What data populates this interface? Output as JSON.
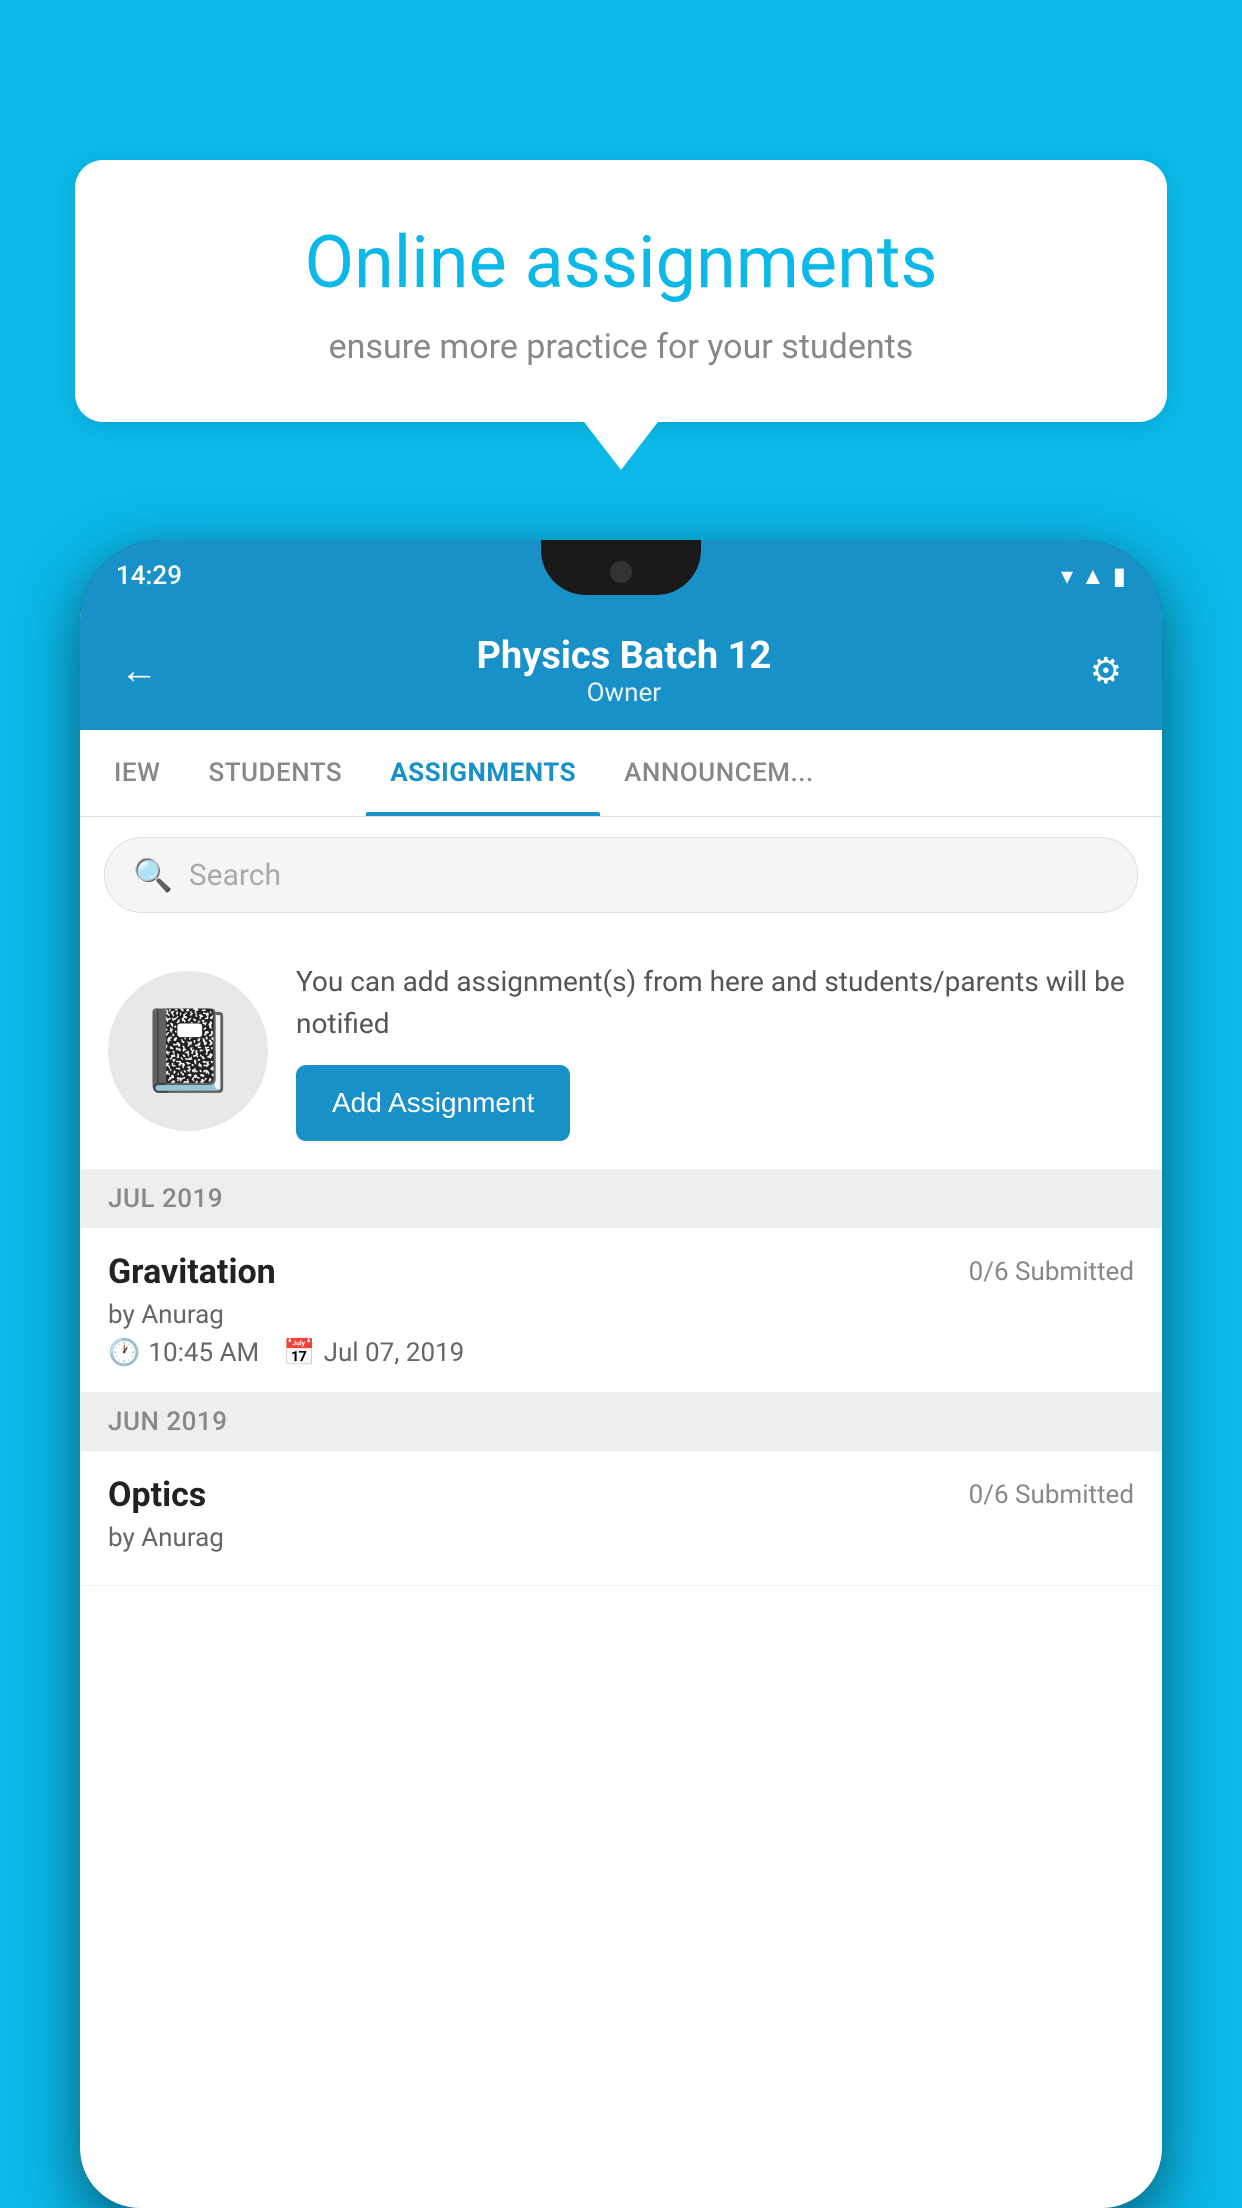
{
  "background_color": "#0BB8E8",
  "speech_bubble": {
    "title": "Online assignments",
    "subtitle": "ensure more practice for your students"
  },
  "phone": {
    "status_bar": {
      "time": "14:29",
      "icons": [
        "wifi",
        "signal",
        "battery"
      ]
    },
    "header": {
      "title": "Physics Batch 12",
      "subtitle": "Owner",
      "back_label": "←",
      "settings_label": "⚙"
    },
    "tabs": [
      {
        "label": "IEW",
        "active": false
      },
      {
        "label": "STUDENTS",
        "active": false
      },
      {
        "label": "ASSIGNMENTS",
        "active": true
      },
      {
        "label": "ANNOUNCEM...",
        "active": false
      }
    ],
    "search": {
      "placeholder": "Search"
    },
    "info_card": {
      "description": "You can add assignment(s) from here and students/parents will be notified",
      "button_label": "Add Assignment"
    },
    "assignment_sections": [
      {
        "month_label": "JUL 2019",
        "assignments": [
          {
            "name": "Gravitation",
            "submitted": "0/6 Submitted",
            "by": "by Anurag",
            "time": "10:45 AM",
            "date": "Jul 07, 2019"
          }
        ]
      },
      {
        "month_label": "JUN 2019",
        "assignments": [
          {
            "name": "Optics",
            "submitted": "0/6 Submitted",
            "by": "by Anurag",
            "time": "",
            "date": ""
          }
        ]
      }
    ]
  }
}
